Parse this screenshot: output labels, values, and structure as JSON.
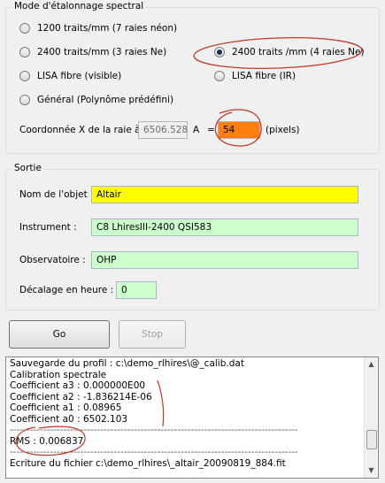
{
  "calibration": {
    "title": "Mode d'étalonnage spectral",
    "options": [
      {
        "label": "1200 traits/mm (7 raies néon)",
        "checked": false
      },
      {
        "label": "2400 traits/mm (3 raies Ne)",
        "checked": false
      },
      {
        "label": "2400 traits /mm (4 raies Ne)",
        "checked": true
      },
      {
        "label": "LISA fibre (visible)",
        "checked": false
      },
      {
        "label": "LISA fibre (IR)",
        "checked": false
      },
      {
        "label": "Général (Polynôme prédéfini)",
        "checked": false
      }
    ],
    "coord_label": "Coordonnée X de la raie à",
    "wavelength_value": "6506.528",
    "angstrom_label": "A",
    "equals": "=",
    "pixel_value": "54",
    "pixels_label": "(pixels)",
    "pixel_field_color": "#ff7f0e"
  },
  "output": {
    "title": "Sortie",
    "object_label": "Nom de l'objet :",
    "object_value": "Altair",
    "object_color": "#ffff00",
    "instrument_label": "Instrument :",
    "instrument_value": "C8 LhiresIII-2400 QSI583",
    "observatory_label": "Observatoire :",
    "observatory_value": "OHP",
    "offset_label": "Décalage en heure :",
    "offset_value": "0",
    "field_green": "#ccffcc"
  },
  "buttons": {
    "go_label": "Go",
    "stop_label": "Stop"
  },
  "log": {
    "lines": [
      "Sauvegarde du profil : c:\\demo_rlhires\\@_calib.dat",
      "Calibration spectrale",
      "Coefficient a3 : 0.000000E00",
      "Coefficient a2 : -1.836214E-06",
      "Coefficient a1 : 0.08965",
      "Coefficient a0 : 6502.103",
      "--------------------------------------------------------------------------------------",
      "RMS : 0.006837",
      "--------------------------------------------------------------------------------------",
      "Ecriture du fichier c:\\demo_rlhires\\_altair_20090819_884.fit"
    ]
  },
  "annotation_color": "#c0392b"
}
